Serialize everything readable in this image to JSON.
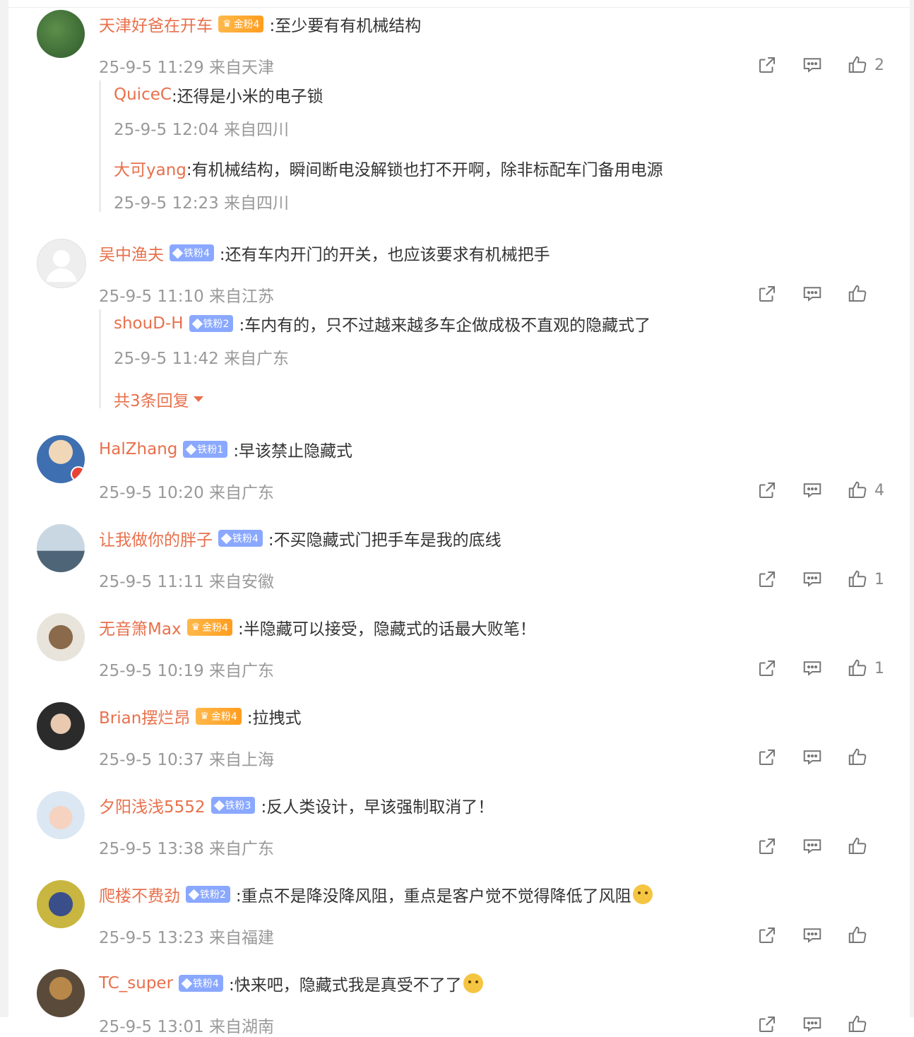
{
  "comments": [
    {
      "user": "天津好爸在开车",
      "fan_badge": "金粉4",
      "fan_type": "jin",
      "text": ":至少要有有机械结构",
      "meta": "25-9-5 11:29 来自天津",
      "likes": "2",
      "replies": [
        {
          "user": "QuiceC",
          "text": ":还得是小米的电子锁",
          "meta": "25-9-5 12:04 来自四川"
        },
        {
          "user": "大可yang",
          "text": ":有机械结构，瞬间断电没解锁也打不开啊，除非标配车门备用电源",
          "meta": "25-9-5 12:23 来自四川"
        }
      ]
    },
    {
      "user": "吴中渔夫",
      "fan_badge": "铁粉4",
      "fan_type": "tie",
      "text": ":还有车内开门的开关，也应该要求有机械把手",
      "meta": "25-9-5 11:10 来自江苏",
      "likes": "",
      "replies": [
        {
          "user": "shouD-H",
          "fan_badge": "铁粉2",
          "text": ":车内有的，只不过越来越多车企做成极不直观的隐藏式了",
          "meta": "25-9-5 11:42 来自广东"
        }
      ],
      "more_replies": "共3条回复"
    },
    {
      "user": "HalZhang",
      "fan_badge": "铁粉1",
      "fan_type": "tie",
      "text": ":早该禁止隐藏式",
      "meta": "25-9-5 10:20 来自广东",
      "likes": "4"
    },
    {
      "user": "让我做你的胖子",
      "fan_badge": "铁粉4",
      "fan_type": "tie",
      "text": ":不买隐藏式门把手车是我的底线",
      "meta": "25-9-5 11:11 来自安徽",
      "likes": "1"
    },
    {
      "user": "无音箫Max",
      "fan_badge": "金粉4",
      "fan_type": "jin",
      "text": ":半隐藏可以接受，隐藏式的话最大败笔！",
      "meta": "25-9-5 10:19 来自广东",
      "likes": "1"
    },
    {
      "user": "Brian摆烂昂",
      "fan_badge": "金粉4",
      "fan_type": "jin",
      "text": ":拉拽式",
      "meta": "25-9-5 10:37 来自上海",
      "likes": ""
    },
    {
      "user": "夕阳浅浅5552",
      "fan_badge": "铁粉3",
      "fan_type": "tie",
      "text": ":反人类设计，早该强制取消了！",
      "meta": "25-9-5 13:38 来自广东",
      "likes": ""
    },
    {
      "user": "爬楼不费劲",
      "fan_badge": "铁粉2",
      "fan_type": "tie",
      "text": ":重点不是降没降风阻，重点是客户觉不觉得降低了风阻",
      "meta": "25-9-5 13:23 来自福建",
      "likes": ""
    },
    {
      "user": "TC_super",
      "fan_badge": "铁粉4",
      "fan_type": "tie",
      "text": ":快来吧，隐藏式我是真受不了了",
      "meta": "25-9-5 13:01 来自湖南",
      "likes": ""
    }
  ],
  "icons": {
    "share": "share-icon",
    "comment": "comment-icon",
    "like": "thumbs-up-icon"
  },
  "colors": {
    "username": "#e8704c",
    "meta": "#999999",
    "tie_badge": "#8aa8ff",
    "jin_badge": "#ffa12e"
  }
}
